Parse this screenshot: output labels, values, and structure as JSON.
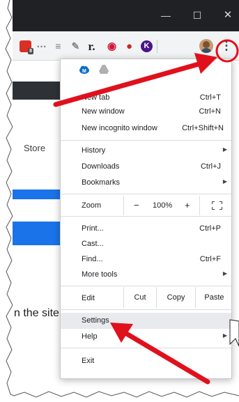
{
  "window": {
    "minimize_glyph": "—",
    "maximize_glyph": "☐",
    "close_glyph": "✕"
  },
  "toolbar": {
    "extensions": [
      {
        "name": "calendar-extension-icon",
        "glyph": "",
        "color": "#d93025",
        "badge": "8"
      },
      {
        "name": "shoe-extension-icon",
        "glyph": "⋯",
        "color": "#6e6e6e"
      },
      {
        "name": "database-extension-icon",
        "glyph": "≡",
        "color": "#7b7b7b"
      },
      {
        "name": "tool-extension-icon",
        "glyph": "✎",
        "color": "#8a8a8a"
      },
      {
        "name": "readability-extension-icon",
        "glyph": "r.",
        "color": "#202124"
      },
      {
        "name": "lastpass-extension-icon",
        "glyph": "◉",
        "color": "#d6163a"
      },
      {
        "name": "adblock-extension-icon",
        "glyph": "●",
        "color": "#c62828"
      },
      {
        "name": "k-extension-icon",
        "glyph": "K",
        "color": "#4a148c"
      }
    ],
    "menu_glyph": "⋮"
  },
  "page": {
    "store_text": "Store",
    "site_text": "n the site"
  },
  "menu": {
    "new_tab": {
      "label": "New tab",
      "shortcut": "Ctrl+T"
    },
    "new_window": {
      "label": "New window",
      "shortcut": "Ctrl+N"
    },
    "new_incognito": {
      "label": "New incognito window",
      "shortcut": "Ctrl+Shift+N"
    },
    "history": {
      "label": "History"
    },
    "downloads": {
      "label": "Downloads",
      "shortcut": "Ctrl+J"
    },
    "bookmarks": {
      "label": "Bookmarks"
    },
    "zoom": {
      "label": "Zoom",
      "minus": "−",
      "value": "100%",
      "plus": "+"
    },
    "print": {
      "label": "Print...",
      "shortcut": "Ctrl+P"
    },
    "cast": {
      "label": "Cast..."
    },
    "find": {
      "label": "Find...",
      "shortcut": "Ctrl+F"
    },
    "more_tools": {
      "label": "More tools"
    },
    "edit": {
      "label": "Edit",
      "cut": "Cut",
      "copy": "Copy",
      "paste": "Paste"
    },
    "settings": {
      "label": "Settings"
    },
    "help": {
      "label": "Help"
    },
    "exit": {
      "label": "Exit"
    },
    "submenu_arrow": "▶"
  },
  "colors": {
    "annotation_red": "#e0101c",
    "accent_blue": "#1a73e8"
  }
}
